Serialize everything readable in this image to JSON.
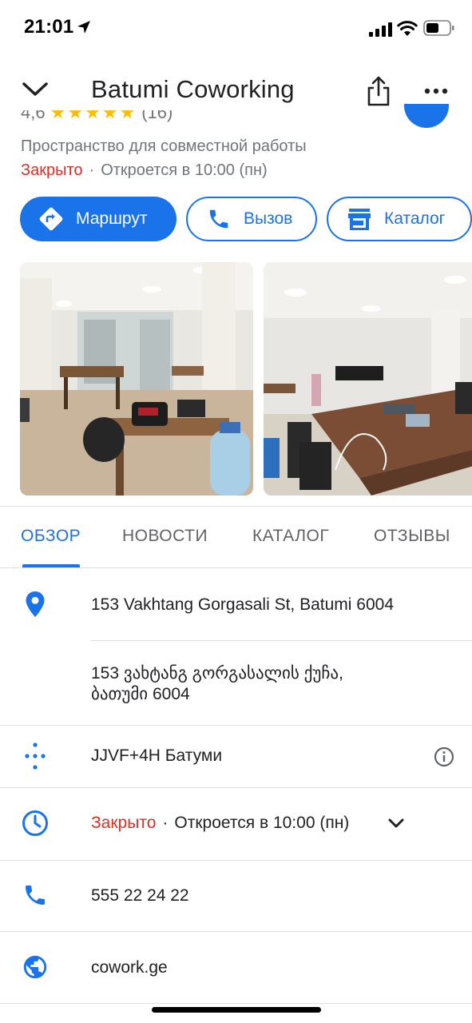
{
  "status_bar": {
    "time": "21:01"
  },
  "header": {
    "title": "Batumi Coworking"
  },
  "summary": {
    "rating": "4,6",
    "stars": "★★★★★",
    "review_count": "(16)",
    "category": "Пространство для совместной работы",
    "status": "Закрыто",
    "opens": "Откроется в 10:00 (пн)"
  },
  "actions": [
    {
      "label": "Маршрут"
    },
    {
      "label": "Вызов"
    },
    {
      "label": "Каталог"
    }
  ],
  "tabs": [
    {
      "label": "ОБЗОР",
      "active": true
    },
    {
      "label": "НОВОСТИ"
    },
    {
      "label": "КАТАЛОГ"
    },
    {
      "label": "ОТЗЫВЫ"
    }
  ],
  "details": {
    "address_latin": "153 Vakhtang Gorgasali St, Batumi 6004",
    "address_local_line1": "153 ვახტანგ გორგასალის ქუჩა,",
    "address_local_line2": "ბათუმი 6004",
    "plus_code": "JJVF+4H Батуми",
    "hours_status": "Закрыто",
    "hours_opens": "Откроется в 10:00 (пн)",
    "phone": "555 22 24 22",
    "website": "cowork.ge"
  },
  "colors": {
    "accent": "#1a73e8",
    "closed": "#d93025",
    "star": "#fbbc04"
  },
  "icons": [
    "location-arrow-icon",
    "signal-icon",
    "wifi-icon",
    "battery-icon",
    "chevron-down-icon",
    "share-icon",
    "more-icon",
    "directions-icon",
    "phone-icon",
    "store-icon",
    "pin-icon",
    "plus-code-icon",
    "info-icon",
    "clock-icon",
    "globe-icon"
  ]
}
